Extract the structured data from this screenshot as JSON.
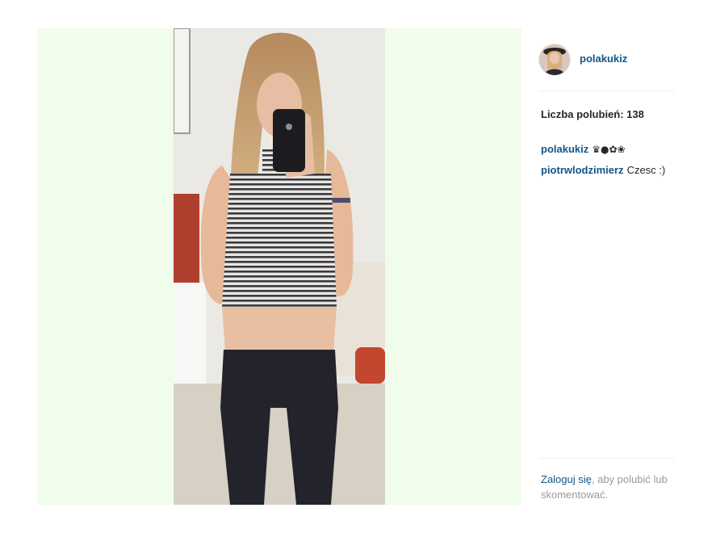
{
  "post": {
    "image_alt": "Selfie w lustrze: dziewczyna w paskowanym crop topie i czarnych spodniach trzyma telefon"
  },
  "header": {
    "username": "polakukiz"
  },
  "likes": {
    "text": "Liczba polubień: 138"
  },
  "comments": [
    {
      "user": "polakukiz",
      "text": "♛●✿❀",
      "text_icons": "crown-balloon-flower-emoji"
    },
    {
      "user": "piotrwlodzimierz",
      "text": "Czesc :)"
    }
  ],
  "footer": {
    "login_link": "Zaloguj się",
    "line1_rest": ", aby polubić lub",
    "line2": "skomentować."
  },
  "colors": {
    "link": "#125688",
    "text": "#262626",
    "muted": "#999999",
    "media_background": "#f0fdea"
  }
}
